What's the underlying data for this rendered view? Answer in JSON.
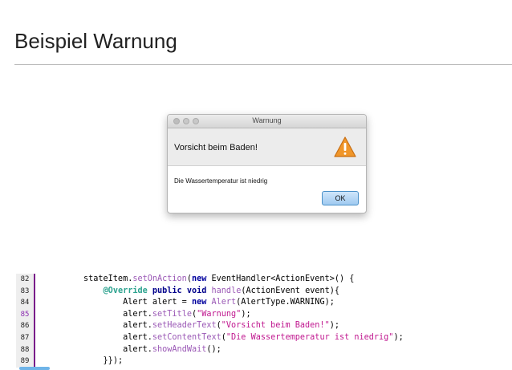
{
  "page": {
    "title": "Beispiel Warnung"
  },
  "dialog": {
    "window_title": "Warnung",
    "header_text": "Vorsicht beim Baden!",
    "content_text": "Die Wassertemperatur ist niedrig",
    "ok_label": "OK",
    "icon": "warning-triangle-icon",
    "icon_color": "#f0962a"
  },
  "code": {
    "lines": [
      {
        "num": "82",
        "indent": "",
        "parts": [
          {
            "t": "stateItem.",
            "c": ""
          },
          {
            "t": "setOnAction",
            "c": "mth"
          },
          {
            "t": "(",
            "c": ""
          },
          {
            "t": "new",
            "c": "kw"
          },
          {
            "t": " EventHandler<ActionEvent>() {",
            "c": ""
          }
        ]
      },
      {
        "num": "83",
        "indent": "    ",
        "parts": [
          {
            "t": "@Override",
            "c": "ann"
          },
          {
            "t": " ",
            "c": ""
          },
          {
            "t": "public",
            "c": "kw2"
          },
          {
            "t": " ",
            "c": ""
          },
          {
            "t": "void",
            "c": "kw2"
          },
          {
            "t": " ",
            "c": ""
          },
          {
            "t": "handle",
            "c": "mth"
          },
          {
            "t": "(ActionEvent event){",
            "c": ""
          }
        ]
      },
      {
        "num": "84",
        "indent": "        ",
        "parts": [
          {
            "t": "Alert alert = ",
            "c": ""
          },
          {
            "t": "new",
            "c": "kw"
          },
          {
            "t": " ",
            "c": ""
          },
          {
            "t": "Alert",
            "c": "mth"
          },
          {
            "t": "(AlertType.WARNING);",
            "c": ""
          }
        ]
      },
      {
        "num": "85",
        "indent": "        ",
        "mark": true,
        "parts": [
          {
            "t": "alert.",
            "c": ""
          },
          {
            "t": "setTitle",
            "c": "mth"
          },
          {
            "t": "(",
            "c": ""
          },
          {
            "t": "\"Warnung\"",
            "c": "str"
          },
          {
            "t": ");",
            "c": ""
          }
        ]
      },
      {
        "num": "86",
        "indent": "        ",
        "parts": [
          {
            "t": "alert.",
            "c": ""
          },
          {
            "t": "setHeaderText",
            "c": "mth"
          },
          {
            "t": "(",
            "c": ""
          },
          {
            "t": "\"Vorsicht beim Baden!\"",
            "c": "str"
          },
          {
            "t": ");",
            "c": ""
          }
        ]
      },
      {
        "num": "87",
        "indent": "        ",
        "parts": [
          {
            "t": "alert.",
            "c": ""
          },
          {
            "t": "setContentText",
            "c": "mth"
          },
          {
            "t": "(",
            "c": ""
          },
          {
            "t": "\"Die Wassertemperatur ist niedrig\"",
            "c": "str"
          },
          {
            "t": ");",
            "c": ""
          }
        ]
      },
      {
        "num": "88",
        "indent": "        ",
        "parts": [
          {
            "t": "alert.",
            "c": ""
          },
          {
            "t": "showAndWait",
            "c": "mth"
          },
          {
            "t": "();",
            "c": ""
          }
        ]
      },
      {
        "num": "89",
        "indent": "    ",
        "parts": [
          {
            "t": "}});",
            "c": ""
          }
        ]
      }
    ]
  }
}
